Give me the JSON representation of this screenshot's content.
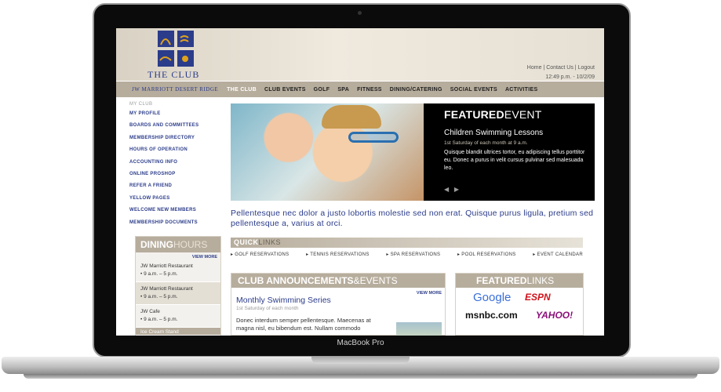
{
  "device": {
    "label": "MacBook Pro"
  },
  "brand": {
    "name": "THE CLUB",
    "club_name": "JW MARRIOTT DESERT RIDGE"
  },
  "top_links": {
    "home": "Home",
    "contact": "Contact Us",
    "logout": "Logout",
    "sep": "|",
    "timestamp": "12:49 p.m. - 10/2/09"
  },
  "nav": [
    "THE CLUB",
    "CLUB EVENTS",
    "GOLF",
    "SPA",
    "FITNESS",
    "DINING/CATERING",
    "SOCIAL EVENTS",
    "ACTIVITIES"
  ],
  "sidebar": {
    "title": "MY CLUB",
    "items": [
      "MY PROFILE",
      "BOARDS AND COMMITTEES",
      "MEMBERSHIP DIRECTORY",
      "HOURS OF OPERATION",
      "ACCOUNTING INFO",
      "ONLINE PROSHOP",
      "REFER A FRIEND",
      "YELLOW PAGES",
      "WELCOME NEW MEMBERS",
      "MEMBERSHIP DOCUMENTS"
    ]
  },
  "dining": {
    "head_a": "DINING",
    "head_b": "HOURS",
    "more": "VIEW MORE",
    "entries": [
      {
        "name": "JW Marriott Restaurant",
        "hours": "• 9 a.m. – 5 p.m."
      },
      {
        "name": "JW Marriott Restaurant",
        "hours": "• 9 a.m. – 5 p.m."
      },
      {
        "name": "JW Cafe",
        "hours": "• 9 a.m. – 5 p.m."
      },
      {
        "name": "Ice Cream Stand",
        "hours": ""
      }
    ]
  },
  "featured": {
    "head_a": "FEATURED",
    "head_b": "EVENT",
    "title": "Children Swimming Lessons",
    "date": "1st Saturday of each month at 9 a.m.",
    "text": "Quisque blandit ultrices tortor, eu adipiscing tellus porttitor eu. Donec a purus in velit cursus pulvinar sed malesuada leo."
  },
  "intro": "Pellentesque nec dolor a justo lobortis molestie sed non erat. Quisque purus ligula, pretium sed pellentesque a, varius at orci.",
  "quicklinks": {
    "head_a": "QUICK",
    "head_b": "LINKS",
    "items": [
      "▸ GOLF RESERVATIONS",
      "▸ TENNIS RESERVATIONS",
      "▸ SPA RESERVATIONS",
      "▸ POOL RESERVATIONS",
      "▸ EVENT CALENDAR"
    ]
  },
  "announcements": {
    "head_a": "CLUB ANNOUNCEMENTS",
    "head_b": "&EVENTS",
    "more": "VIEW MORE",
    "title": "Monthly Swimming Series",
    "date": "1st Saturday of each month",
    "text": "Donec interdum semper pellentesque. Maecenas at magna nisl, eu bibendum est. Nullam commodo"
  },
  "featured_links": {
    "head_a": "FEATURED",
    "head_b": "LINKS",
    "logos": [
      "Google",
      "ESPN",
      "msnbc.com",
      "YAHOO!"
    ]
  }
}
